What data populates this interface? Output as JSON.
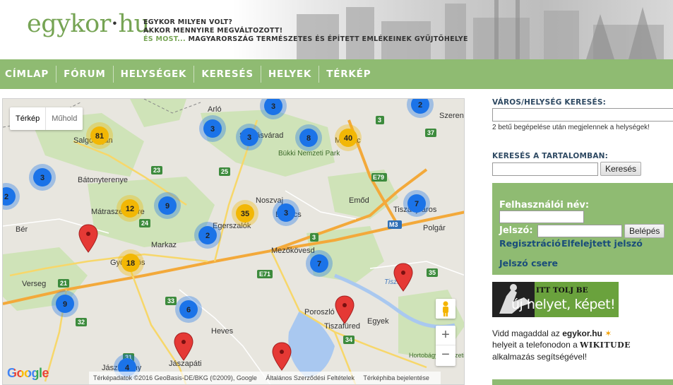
{
  "header": {
    "logo_main": "egykor",
    "logo_dot": "·",
    "logo_tld": "hu",
    "tagline_1": "EGYKOR MILYEN VOLT?",
    "tagline_2": "AKKOR MENNYIRE MEGVÁLTOZOTT!",
    "tagline_3_accent": "ÉS MOST...",
    "tagline_3_rest": "MAGYARORSZÁG TERMÉSZETES ÉS ÉPÍTETT EMLÉKEINEK GYŰJTŐHELYE"
  },
  "nav": {
    "items": [
      {
        "label": "CÍMLAP"
      },
      {
        "label": "FÓRUM"
      },
      {
        "label": "HELYSÉGEK"
      },
      {
        "label": "KERESÉS"
      },
      {
        "label": "HELYEK"
      },
      {
        "label": "TÉRKÉP"
      }
    ]
  },
  "map": {
    "type_map": "Térkép",
    "type_satellite": "Műhold",
    "zoom_in": "+",
    "zoom_out": "−",
    "google": "Google",
    "attribution": "Térképadatok ©2016 GeoBasis-DE/BKG (©2009), Google",
    "terms": "Általános Szerződési Feltételek",
    "report": "Térképhiba bejelentése",
    "places": [
      {
        "name": "Salgótarján"
      },
      {
        "name": "Bátonyterenye"
      },
      {
        "name": "Mátraszentimre"
      },
      {
        "name": "Bér"
      },
      {
        "name": "Markaz"
      },
      {
        "name": "Gyöngyös"
      },
      {
        "name": "Verseg"
      },
      {
        "name": "Heves"
      },
      {
        "name": "Jászapáti"
      },
      {
        "name": "Jászberény"
      },
      {
        "name": "Arló"
      },
      {
        "name": "Szilvásvárad"
      },
      {
        "name": "Bükki Nemzeti Park"
      },
      {
        "name": "Miskolc"
      },
      {
        "name": "Noszvaj"
      },
      {
        "name": "Bogács"
      },
      {
        "name": "Egerszalók"
      },
      {
        "name": "Mezőkövesd"
      },
      {
        "name": "Emőd"
      },
      {
        "name": "Tiszaújváros"
      },
      {
        "name": "Polgár"
      },
      {
        "name": "Szerencs"
      },
      {
        "name": "Poroszló"
      },
      {
        "name": "Tiszafüred"
      },
      {
        "name": "Egyek"
      },
      {
        "name": "Hortobágyi Nemzeti Park"
      },
      {
        "name": "Tisza"
      }
    ],
    "clusters": [
      {
        "count": "81",
        "color": "#f2b705"
      },
      {
        "count": "3",
        "color": "#1b73e8"
      },
      {
        "count": "2",
        "color": "#1b73e8"
      },
      {
        "count": "12",
        "color": "#f2b705"
      },
      {
        "count": "9",
        "color": "#1b73e8"
      },
      {
        "count": "35",
        "color": "#f2b705"
      },
      {
        "count": "3",
        "color": "#1b73e8"
      },
      {
        "count": "2",
        "color": "#1b73e8"
      },
      {
        "count": "18",
        "color": "#f2b705"
      },
      {
        "count": "3",
        "color": "#1b73e8"
      },
      {
        "count": "3",
        "color": "#1b73e8"
      },
      {
        "count": "3",
        "color": "#1b73e8"
      },
      {
        "count": "8",
        "color": "#1b73e8"
      },
      {
        "count": "40",
        "color": "#f2b705"
      },
      {
        "count": "2",
        "color": "#1b73e8"
      },
      {
        "count": "7",
        "color": "#1b73e8"
      },
      {
        "count": "7",
        "color": "#1b73e8"
      },
      {
        "count": "9",
        "color": "#1b73e8"
      },
      {
        "count": "6",
        "color": "#1b73e8"
      },
      {
        "count": "4",
        "color": "#1b73e8"
      }
    ],
    "roads": [
      "21",
      "23",
      "25",
      "24",
      "3",
      "E71",
      "33",
      "32",
      "31",
      "34",
      "E79",
      "M3",
      "37",
      "35",
      "3"
    ]
  },
  "sidebar": {
    "city_search_label": "VÁROS/HELYSÉG KERESÉS:",
    "city_search_hint": "2 betű begépelése után megjelennek a helységek!",
    "content_search_label": "KERESÉS A TARTALOMBAN:",
    "search_button": "Keresés",
    "username_label": "Felhasználói név:",
    "password_label": "Jelszó:",
    "login_button": "Belépés",
    "register_link": "Regisztráció",
    "forgot_link": "Elfelejtett jelszó",
    "change_password_link": "Jelszó csere",
    "banner_line1": "ITT TOLJ BE",
    "banner_line2": "új helyet, képet!",
    "wiki_text_1": "Vidd magaddal az",
    "wiki_brand": "egykor.hu",
    "wiki_text_2": "helyeit a telefonodon a",
    "wiki_app": "WIKITUDE",
    "wiki_text_3": "alkalmazás segítségével!"
  }
}
